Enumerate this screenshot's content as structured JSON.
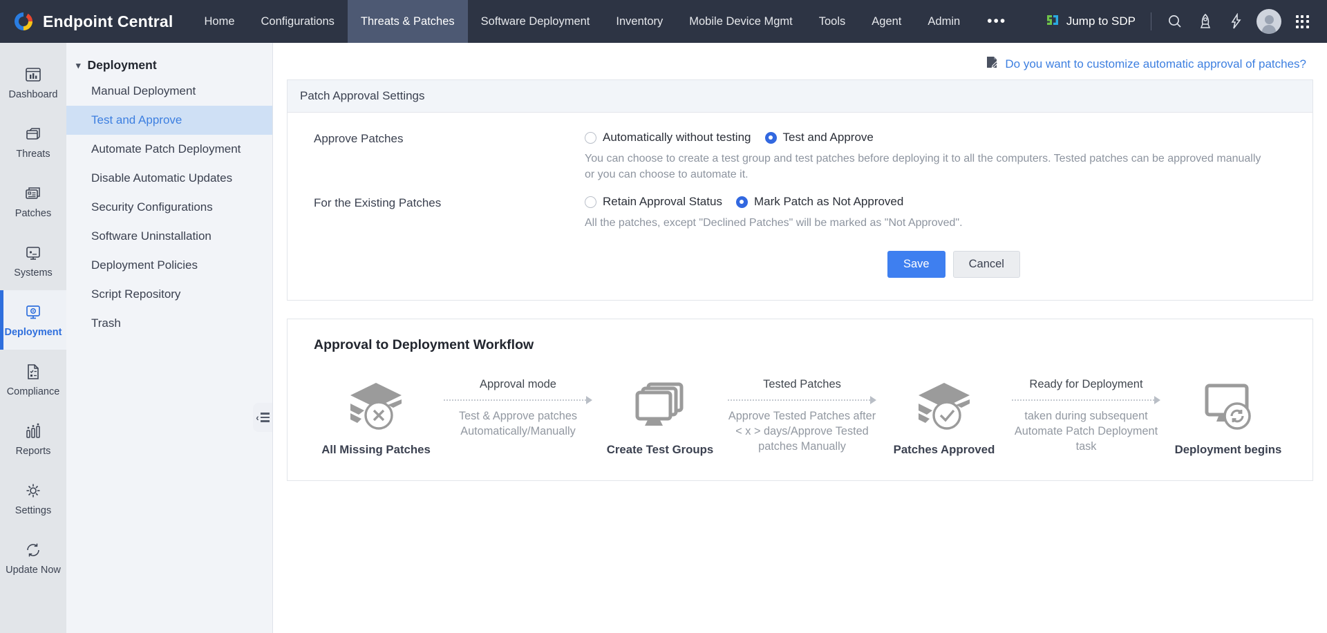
{
  "app": {
    "brand": "Endpoint Central",
    "logo_icon": "endpoint-central-logo-icon"
  },
  "topnav": {
    "items": [
      {
        "label": "Home",
        "active": false
      },
      {
        "label": "Configurations",
        "active": false
      },
      {
        "label": "Threats & Patches",
        "active": true
      },
      {
        "label": "Software Deployment",
        "active": false
      },
      {
        "label": "Inventory",
        "active": false
      },
      {
        "label": "Mobile Device Mgmt",
        "active": false
      },
      {
        "label": "Tools",
        "active": false
      },
      {
        "label": "Agent",
        "active": false
      },
      {
        "label": "Admin",
        "active": false
      }
    ],
    "overflow_label": "•••",
    "jump_to_sdp": "Jump to SDP",
    "icons": [
      "search-icon",
      "rocket-icon",
      "bolt-icon",
      "avatar",
      "app-grid-icon"
    ]
  },
  "rail": {
    "items": [
      {
        "label": "Dashboard",
        "icon": "dashboard-chart-icon",
        "active": false
      },
      {
        "label": "Threats",
        "icon": "threats-box-icon",
        "active": false
      },
      {
        "label": "Patches",
        "icon": "patches-card-icon",
        "active": false
      },
      {
        "label": "Systems",
        "icon": "systems-monitor-icon",
        "active": false
      },
      {
        "label": "Deployment",
        "icon": "deployment-gear-monitor-icon",
        "active": true
      },
      {
        "label": "Compliance",
        "icon": "compliance-document-icon",
        "active": false
      },
      {
        "label": "Reports",
        "icon": "reports-bars-icon",
        "active": false
      },
      {
        "label": "Settings",
        "icon": "gear-icon",
        "active": false
      },
      {
        "label": "Update Now",
        "icon": "refresh-icon",
        "active": false
      }
    ]
  },
  "sidebar": {
    "group_title": "Deployment",
    "items": [
      {
        "label": "Manual Deployment",
        "active": false
      },
      {
        "label": "Test and Approve",
        "active": true
      },
      {
        "label": "Automate Patch Deployment",
        "active": false
      },
      {
        "label": "Disable Automatic Updates",
        "active": false
      },
      {
        "label": "Security Configurations",
        "active": false
      },
      {
        "label": "Software Uninstallation",
        "active": false
      },
      {
        "label": "Deployment Policies",
        "active": false
      },
      {
        "label": "Script Repository",
        "active": false
      },
      {
        "label": "Trash",
        "active": false
      }
    ],
    "collapse_icon": "collapse-sidebar-icon"
  },
  "main": {
    "customize_link": "Do you want to customize automatic approval of patches?",
    "customize_link_icon": "edit-note-icon",
    "card_title": "Patch Approval Settings",
    "approve_patches": {
      "label": "Approve Patches",
      "options": [
        {
          "label": "Automatically without testing",
          "selected": false
        },
        {
          "label": "Test and Approve",
          "selected": true
        }
      ],
      "hint": "You can choose to create a test group and test patches before deploying it to all the computers. Tested patches can be approved manually or you can choose to automate it."
    },
    "existing_patches": {
      "label": "For the Existing Patches",
      "options": [
        {
          "label": "Retain Approval Status",
          "selected": false
        },
        {
          "label": "Mark Patch as Not Approved",
          "selected": true
        }
      ],
      "hint": "All the patches, except \"Declined Patches\" will be marked as \"Not Approved\"."
    },
    "save_label": "Save",
    "cancel_label": "Cancel",
    "accent_color": "#3e7ff0"
  },
  "workflow": {
    "title": "Approval to Deployment Workflow",
    "nodes": [
      {
        "label": "All Missing Patches",
        "icon": "patch-stack-cross-icon"
      },
      {
        "label": "Create Test Groups",
        "icon": "monitor-stack-icon"
      },
      {
        "label": "Patches Approved",
        "icon": "patch-stack-check-icon"
      },
      {
        "label": "Deployment begins",
        "icon": "monitor-refresh-icon"
      }
    ],
    "arrows": [
      {
        "title": "Approval mode",
        "desc": "Test & Approve patches Automatically/Manually"
      },
      {
        "title": "Tested Patches",
        "desc": "Approve Tested Patches after < x > days/Approve Tested patches Manually"
      },
      {
        "title": "Ready for Deployment",
        "desc": "taken during subsequent Automate Patch Deployment task"
      }
    ]
  }
}
